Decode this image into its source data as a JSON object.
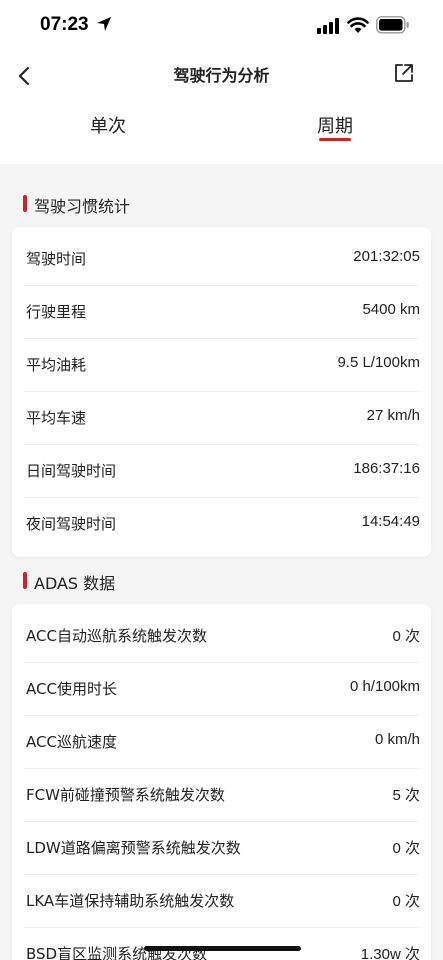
{
  "status": {
    "time": "07:23"
  },
  "nav": {
    "title": "驾驶行为分析"
  },
  "tabs": [
    {
      "label": "单次",
      "active": false
    },
    {
      "label": "周期",
      "active": true
    }
  ],
  "habits": {
    "title": "驾驶习惯统计",
    "rows": [
      {
        "label": "驾驶时间",
        "value": "201:32:05"
      },
      {
        "label": "行驶里程",
        "value": "5400 km"
      },
      {
        "label": "平均油耗",
        "value": "9.5 L/100km"
      },
      {
        "label": "平均车速",
        "value": "27 km/h"
      },
      {
        "label": "日间驾驶时间",
        "value": "186:37:16"
      },
      {
        "label": "夜间驾驶时间",
        "value": "14:54:49"
      }
    ]
  },
  "adas": {
    "title": "ADAS 数据",
    "rows": [
      {
        "label": "ACC自动巡航系统触发次数",
        "value": "0 次"
      },
      {
        "label": "ACC使用时长",
        "value": "0 h/100km"
      },
      {
        "label": "ACC巡航速度",
        "value": "0 km/h"
      },
      {
        "label": "FCW前碰撞预警系统触发次数",
        "value": "5 次"
      },
      {
        "label": "LDW道路偏离预警系统触发次数",
        "value": "0 次"
      },
      {
        "label": "LKA车道保持辅助系统触发次数",
        "value": "0 次"
      },
      {
        "label": "BSD盲区监测系统触发次数",
        "value": "1.30w 次"
      }
    ]
  },
  "colors": {
    "accent": "#d0202a",
    "background": "#f5f5f5",
    "card": "#ffffff"
  }
}
